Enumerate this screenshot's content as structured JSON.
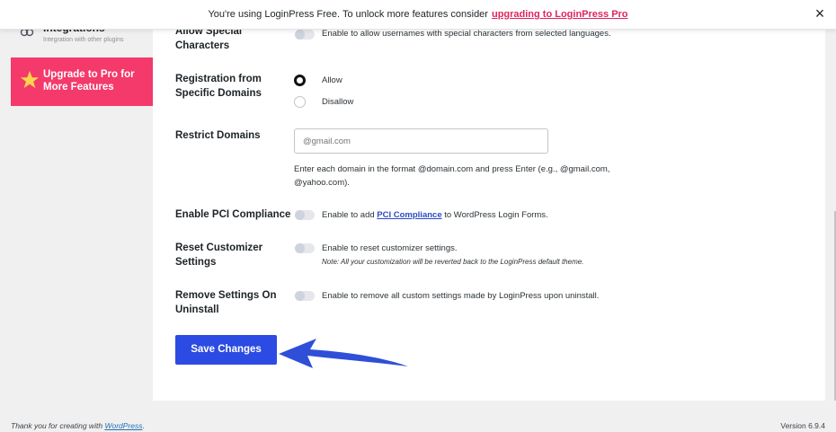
{
  "notice": {
    "text": "You're using LoginPress Free. To unlock more features consider",
    "link": "upgrading to LoginPress Pro",
    "close": "×"
  },
  "sidebar": {
    "integrations_title": "Integrations",
    "integrations_sub": "Integration with other plugins",
    "upgrade_label": "Upgrade to Pro for More Features"
  },
  "settings": {
    "allow_special": {
      "label": "Allow Special Characters",
      "desc": "Enable to allow usernames with special characters from selected languages."
    },
    "registration_domains": {
      "label": "Registration from Specific Domains",
      "options": [
        "Allow",
        "Disallow"
      ],
      "selected": "Allow"
    },
    "restrict_domains": {
      "label": "Restrict Domains",
      "placeholder": "@gmail.com",
      "help": "Enter each domain in the format @domain.com and press Enter (e.g., @gmail.com, @yahoo.com)."
    },
    "pci": {
      "label": "Enable PCI Compliance",
      "desc_before": "Enable to add",
      "desc_link": "PCI Compliance",
      "desc_after": "to WordPress Login Forms."
    },
    "reset_customizer": {
      "label": "Reset Customizer Settings",
      "desc": "Enable to reset customizer settings.",
      "note": "Note: All your customization will be reverted back to the LoginPress default theme."
    },
    "remove_settings": {
      "label": "Remove Settings On Uninstall",
      "desc": "Enable to remove all custom settings made by LoginPress upon uninstall."
    }
  },
  "save_label": "Save Changes",
  "footer": {
    "thanks": "Thank you for creating with",
    "wp": "WordPress",
    "period": ".",
    "version": "Version 6.9.4"
  },
  "colors": {
    "accent_pink": "#f4396b",
    "save_blue": "#2c4be3",
    "arrow_blue": "#2f4fd8"
  }
}
